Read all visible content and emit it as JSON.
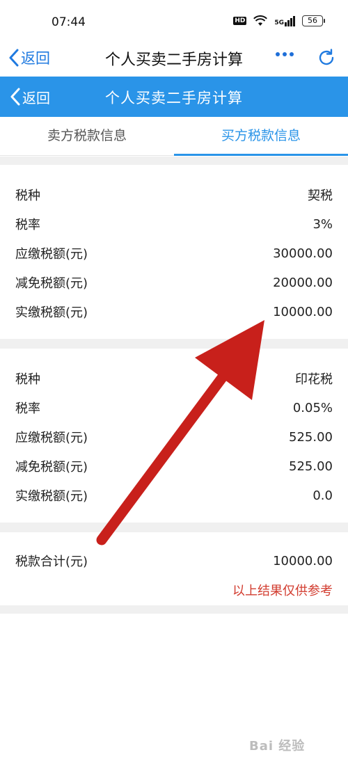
{
  "status_bar": {
    "time": "07:44",
    "hd": "HD",
    "network": "5G",
    "battery": "56"
  },
  "browser": {
    "back_label": "返回",
    "title": "个人买卖二手房计算"
  },
  "app_header": {
    "back_label": "返回",
    "title": "个人买卖二手房计算"
  },
  "tabs": [
    {
      "label": "卖方税款信息",
      "active": false
    },
    {
      "label": "买方税款信息",
      "active": true
    }
  ],
  "sections": [
    {
      "rows": [
        {
          "label": "税种",
          "value": "契税"
        },
        {
          "label": "税率",
          "value": "3%"
        },
        {
          "label": "应缴税额(元)",
          "value": "30000.00"
        },
        {
          "label": "减免税额(元)",
          "value": "20000.00"
        },
        {
          "label": "实缴税额(元)",
          "value": "10000.00"
        }
      ]
    },
    {
      "rows": [
        {
          "label": "税种",
          "value": "印花税"
        },
        {
          "label": "税率",
          "value": "0.05%"
        },
        {
          "label": "应缴税额(元)",
          "value": "525.00"
        },
        {
          "label": "减免税额(元)",
          "value": "525.00"
        },
        {
          "label": "实缴税额(元)",
          "value": "0.0"
        }
      ]
    }
  ],
  "total": {
    "label": "税款合计(元)",
    "value": "10000.00",
    "note": "以上结果仅供参考"
  },
  "colors": {
    "primary": "#2a94e8",
    "browser_accent": "#1f7ae0",
    "note_red": "#d23c2f",
    "arrow_red": "#c8201b"
  },
  "watermark": "Bai 经验"
}
